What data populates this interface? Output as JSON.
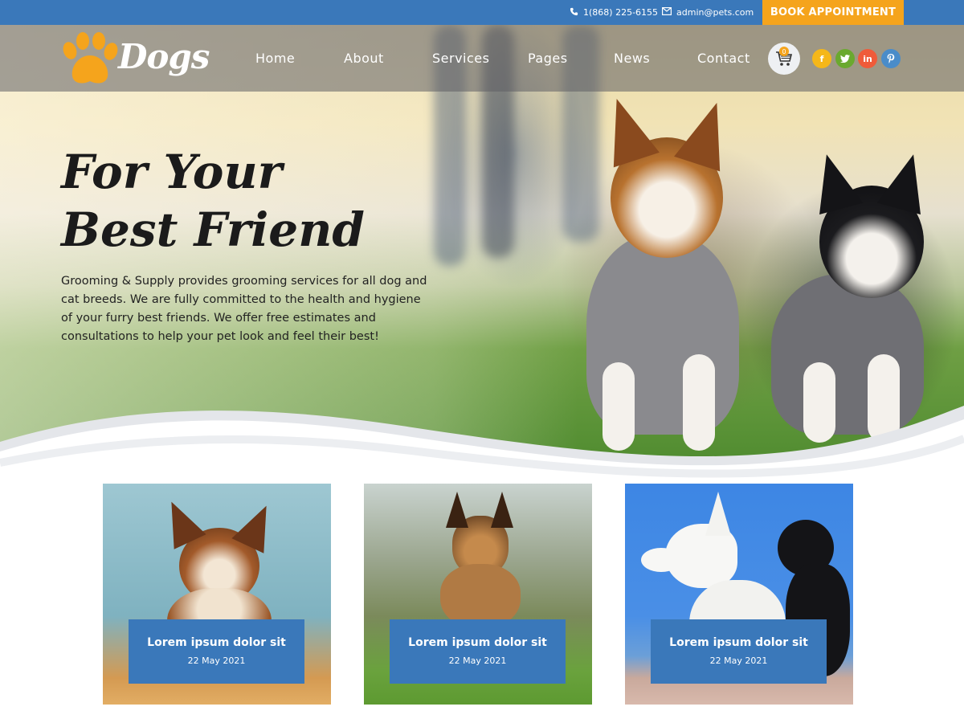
{
  "topbar": {
    "phone": "1(868) 225-6155",
    "email": "admin@pets.com",
    "book_label": "BOOK APPOINTMENT"
  },
  "brand": {
    "name": "Dogs",
    "accent": "#f5a41c",
    "primary": "#3a78ba"
  },
  "nav": {
    "items": [
      "Home",
      "About",
      "Services",
      "Pages",
      "News",
      "Contact"
    ]
  },
  "cart": {
    "count": "0",
    "icon": "shopping-cart-icon"
  },
  "social": [
    {
      "name": "facebook-icon",
      "glyph": "f",
      "color": "#f5b719"
    },
    {
      "name": "twitter-icon",
      "glyph": "t",
      "color": "#6aa92f"
    },
    {
      "name": "linkedin-icon",
      "glyph": "in",
      "color": "#ef5b3a"
    },
    {
      "name": "pinterest-icon",
      "glyph": "p",
      "color": "#4a8cc9"
    }
  ],
  "hero": {
    "headline_line1": "For Your",
    "headline_line2": "Best Friend",
    "description": "Grooming & Supply provides grooming services for all dog and cat breeds. We are fully committed to the health and hygiene of your furry best friends. We offer free estimates and consultations to help your pet look and feel their best!"
  },
  "cards": [
    {
      "title": "Lorem ipsum dolor sit",
      "date": "22 May 2021"
    },
    {
      "title": "Lorem ipsum dolor sit",
      "date": "22 May 2021"
    },
    {
      "title": "Lorem ipsum dolor sit",
      "date": "22 May 2021"
    }
  ]
}
